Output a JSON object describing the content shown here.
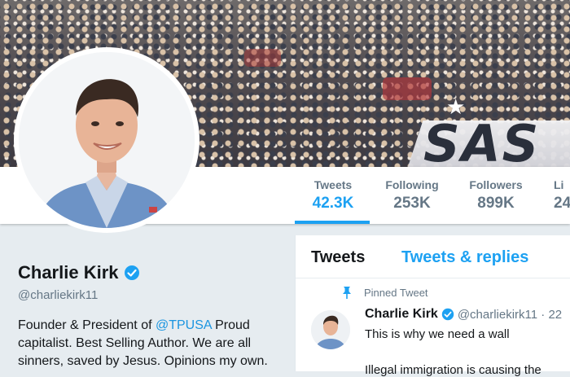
{
  "banner": {
    "sign_text": "SAS"
  },
  "nav": {
    "stats": [
      {
        "label": "Tweets",
        "value": "42.3K"
      },
      {
        "label": "Following",
        "value": "253K"
      },
      {
        "label": "Followers",
        "value": "899K"
      },
      {
        "label": "Li",
        "value": "24"
      }
    ]
  },
  "profile": {
    "name": "Charlie Kirk",
    "handle": "@charliekirk11",
    "bio_before": "Founder & President of ",
    "bio_link": "@TPUSA",
    "bio_after": " Proud capitalist. Best Selling Author. We are all sinners, saved by Jesus. Opinions my own."
  },
  "timeline": {
    "tabs": [
      "Tweets",
      "Tweets & replies"
    ],
    "pinned_label": "Pinned Tweet",
    "tweet": {
      "name": "Charlie Kirk",
      "handle_time": "@charliekirk11 · 22",
      "text": "This is why we need a wall",
      "text2": "Illegal immigration is causing the"
    }
  },
  "colors": {
    "accent": "#1da1f2",
    "link": "#1b95e0",
    "muted": "#657786",
    "background": "#e6ecf0"
  }
}
